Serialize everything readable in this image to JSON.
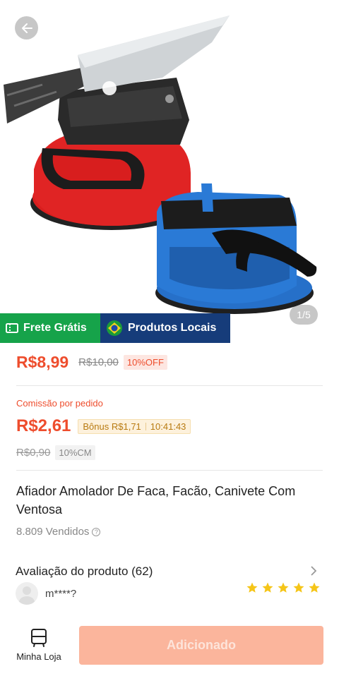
{
  "gallery": {
    "page_indicator": "1/5"
  },
  "badges": {
    "free_shipping": "Frete Grátis",
    "local_products": "Produtos Locais"
  },
  "price": {
    "current": "R$8,99",
    "original": "R$10,00",
    "discount": "10%OFF"
  },
  "commission": {
    "label": "Comissão por pedido",
    "value": "R$2,61",
    "bonus": "Bônus R$1,71",
    "countdown": "10:41:43",
    "original": "R$0,90",
    "rate_tag": "10%CM"
  },
  "product": {
    "title": "Afiador Amolador De Faca, Facão, Canivete Com Ventosa",
    "sold": "8.809 Vendidos"
  },
  "reviews": {
    "title": "Avaliação do produto (62)",
    "reviewer": "m****?",
    "rating": 5
  },
  "bottom": {
    "store_label": "Minha Loja",
    "add_label": "Adicionado"
  },
  "colors": {
    "accent": "#ee4d2d",
    "free_shipping": "#16a34a",
    "local_products": "#163c7a",
    "star": "#f5c518",
    "add_button": "#fbb59c"
  }
}
